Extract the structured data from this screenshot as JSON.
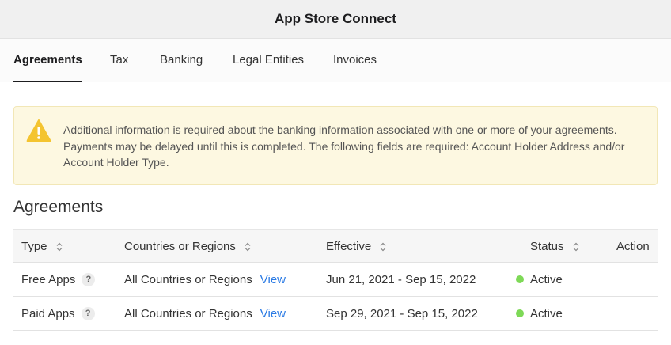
{
  "app": {
    "title": "App Store Connect"
  },
  "tabs": [
    {
      "label": "Agreements",
      "active": true
    },
    {
      "label": "Tax",
      "active": false
    },
    {
      "label": "Banking",
      "active": false
    },
    {
      "label": "Legal Entities",
      "active": false
    },
    {
      "label": "Invoices",
      "active": false
    }
  ],
  "alert": {
    "icon": "warning-triangle-icon",
    "text": "Additional information is required about the banking information associated with one or more of your agreements. Payments may be delayed until this is completed. The following fields are required: Account Holder Address and/or Account Holder Type."
  },
  "section": {
    "title": "Agreements"
  },
  "table": {
    "headers": {
      "type": "Type",
      "countries": "Countries or Regions",
      "effective": "Effective",
      "status": "Status",
      "action": "Action"
    },
    "rows": [
      {
        "type": "Free Apps",
        "help": "?",
        "countries": "All Countries or Regions",
        "link": "View",
        "effective": "Jun 21, 2021 - Sep 15, 2022",
        "status": "Active"
      },
      {
        "type": "Paid Apps",
        "help": "?",
        "countries": "All Countries or Regions",
        "link": "View",
        "effective": "Sep 29, 2021 - Sep 15, 2022",
        "status": "Active"
      }
    ]
  },
  "colors": {
    "accent_link": "#2a7ae4",
    "status_active": "#7ed957",
    "alert_bg": "#fdf8e1",
    "warning": "#f4c430"
  }
}
